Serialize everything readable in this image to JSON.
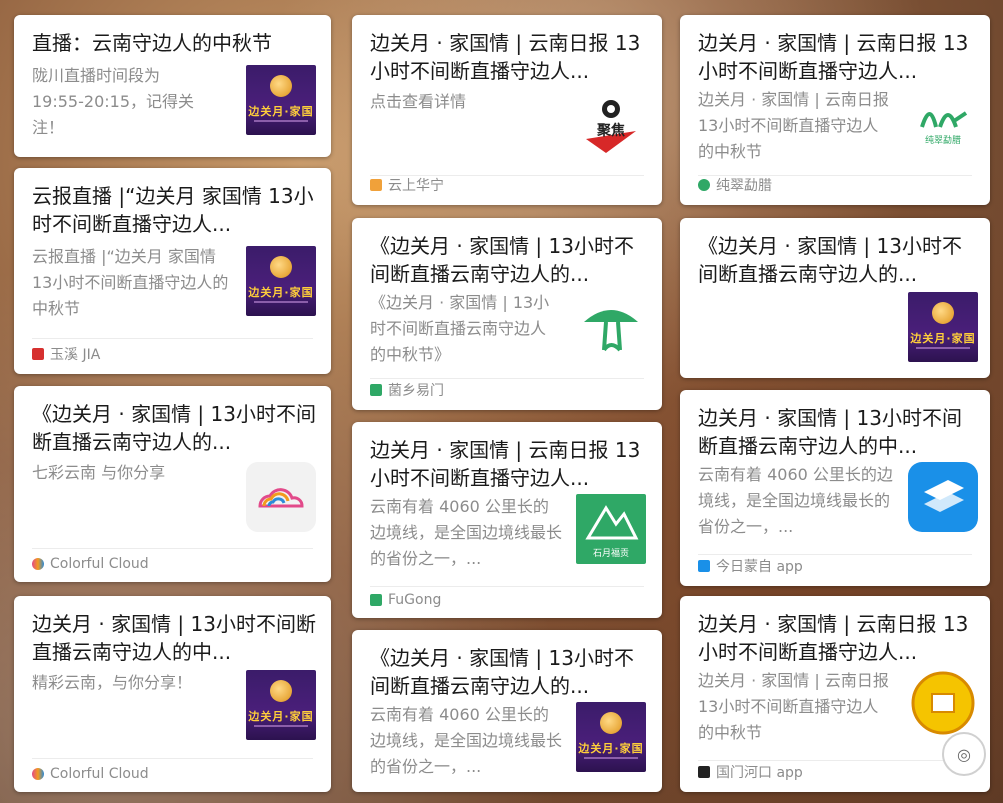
{
  "cards": [
    {
      "title": "直播：云南守边人的中秋节",
      "desc": "陇川直播时间段为 19:55-20:15，记得关注！",
      "source": ""
    },
    {
      "title": "云报直播 |“边关月  家国情 13小时不间断直播守边人...",
      "desc": "云报直播 |“边关月  家国情13小时不间断直播守边人的中秋节",
      "source": "玉溪 JIA"
    },
    {
      "title": "《边关月 · 家国情 | 13小时不间断直播云南守边人的...",
      "desc": "七彩云南 与你分享",
      "source": "Colorful Cloud"
    },
    {
      "title": "边关月 · 家国情 | 13小时不间断直播云南守边人的中...",
      "desc": "精彩云南，与你分享！",
      "source": "Colorful Cloud"
    },
    {
      "title": "边关月 · 家国情 | 云南日报 13小时不间断直播守边人...",
      "desc": "点击查看详情",
      "source": "云上华宁"
    },
    {
      "title": "《边关月 · 家国情 | 13小时不间断直播云南守边人的...",
      "desc": "《边关月 · 家国情 | 13小时不间断直播云南守边人的中秋节》",
      "source": "菌乡易门"
    },
    {
      "title": "边关月 · 家国情 | 云南日报 13小时不间断直播守边人...",
      "desc": "云南有着 4060 公里长的边境线，是全国边境线最长的省份之一，...",
      "source": "FuGong"
    },
    {
      "title": "《边关月 · 家国情 | 13小时不间断直播云南守边人的...",
      "desc": "云南有着 4060 公里长的边境线，是全国边境线最长的省份之一，...",
      "source": ""
    },
    {
      "title": "边关月 · 家国情 | 云南日报 13小时不间断直播守边人...",
      "desc": "边关月 · 家国情 | 云南日报 13小时不间断直播守边人的中秋节",
      "source": "纯翠勐腊"
    },
    {
      "title": "《边关月 · 家国情 | 13小时不间断直播云南守边人的...",
      "desc": "",
      "source": ""
    },
    {
      "title": "边关月 · 家国情 | 13小时不间断直播云南守边人的中...",
      "desc": "云南有着 4060 公里长的边境线，是全国边境线最长的省份之一，...",
      "source": "今日蒙自 app"
    },
    {
      "title": "边关月 · 家国情 | 云南日报 13小时不间断直播守边人...",
      "desc": "边关月 · 家国情 | 云南日报 13小时不间断直播守边人的中秋节",
      "source": "国门河口 app"
    }
  ],
  "thumbs": {
    "poster_text": "边关月·家国",
    "juji_text": "聚焦",
    "shiyue_text": "石月福贡",
    "chuncui_text": "纯翠勐腊"
  },
  "colors": {
    "purple": "#3b1c6a",
    "gold": "#ffcf3a",
    "green": "#2fa866",
    "blue": "#1a90e8",
    "yellow": "#f5c400"
  }
}
